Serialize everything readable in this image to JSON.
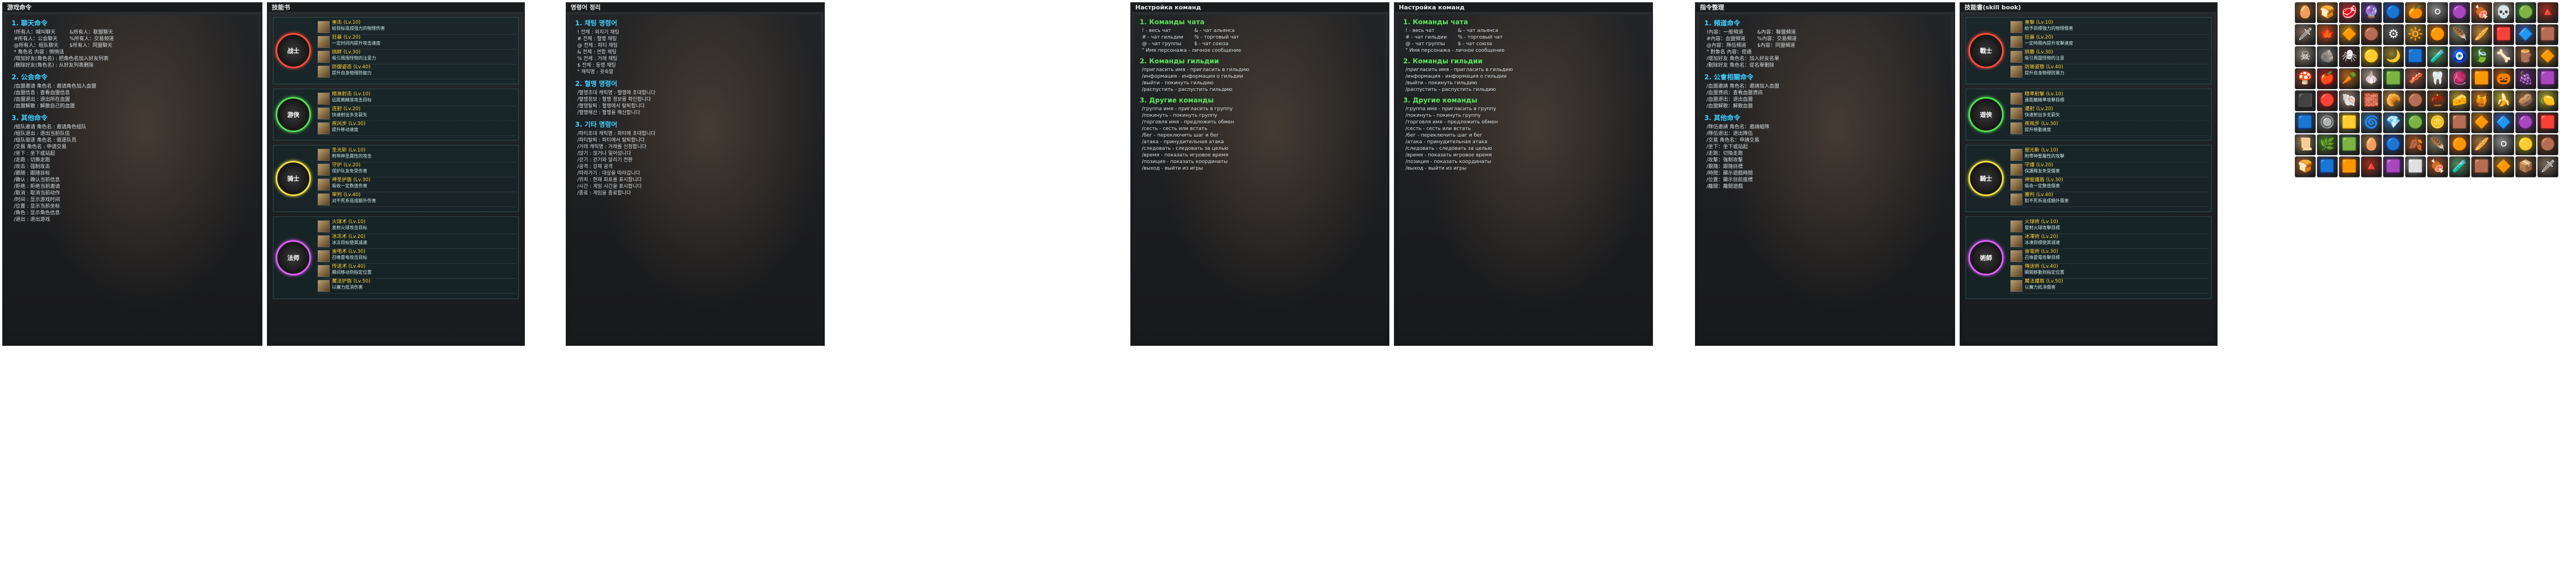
{
  "panels": {
    "p1": {
      "title": "游戏命令",
      "sections": [
        {
          "title": "1. 聊天命令",
          "cols": [
            [
              "!所有人：喊叫聊天",
              "#所有人：公会聊天",
              "@所有人：组队聊天"
            ],
            [
              "&所有人：联盟聊天",
              "%所有人：交易频道",
              "$所有人：同盟聊天"
            ]
          ],
          "lines": [
            "* 角色名 内容 : 悄悄话",
            "/增加好友(角色名) : 把角色名加入好友列表",
            "/删除好友(角色名) : 从好友列表删除"
          ]
        },
        {
          "title": "2. 公会命令",
          "lines": [
            "/血盟邀请 角色名 : 邀请角色加入血盟",
            "/血盟信息 : 查看血盟信息",
            "/血盟退出 : 退出所在血盟",
            "/血盟解散 : 解散自己的血盟"
          ]
        },
        {
          "title": "3. 其他命令",
          "lines": [
            "/组队邀请 角色名 : 邀请角色组队",
            "/组队退出 : 退出当前队伍",
            "/组队驱逐 角色名 : 驱逐队员",
            "/交易 角色名 : 申请交易",
            "/坐下 : 坐下或站起",
            "/走跑 : 切换走跑",
            "/攻击 : 强制攻击",
            "/跟随 : 跟随目标",
            "/确认 : 确认当前信息",
            "/拒绝 : 拒绝当前邀请",
            "/取消 : 取消当前动作",
            "/时间 : 显示游戏时间",
            "/位置 : 显示当前坐标",
            "/角色 : 显示角色信息",
            "/退出 : 退出游戏"
          ]
        }
      ]
    },
    "p2": {
      "title": "技能书",
      "groups": [
        {
          "badge": "战士",
          "color": "red",
          "skills": [
            {
              "name": "重击 (Lv.10)",
              "desc": "给目标造成强力的物理伤害"
            },
            {
              "name": "狂暴 (Lv.20)",
              "desc": "一定时间内提升攻击速度"
            },
            {
              "name": "挑衅 (Lv.30)",
              "desc": "吸引周围怪物的注意力"
            },
            {
              "name": "防御姿态 (Lv.40)",
              "desc": "提升自身物理防御力"
            }
          ]
        },
        {
          "badge": "游侠",
          "color": "green",
          "skills": [
            {
              "name": "精准射击 (Lv.10)",
              "desc": "远距离精准攻击目标"
            },
            {
              "name": "连射 (Lv.20)",
              "desc": "快速射出多支箭矢"
            },
            {
              "name": "疾风步 (Lv.30)",
              "desc": "提升移动速度"
            }
          ]
        },
        {
          "badge": "骑士",
          "color": "yellow",
          "skills": [
            {
              "name": "圣光斩 (Lv.10)",
              "desc": "附带神圣属性的攻击"
            },
            {
              "name": "守护 (Lv.20)",
              "desc": "保护队友免受伤害"
            },
            {
              "name": "神圣护盾 (Lv.30)",
              "desc": "吸收一定数值伤害"
            },
            {
              "name": "审判 (Lv.40)",
              "desc": "对不死系造成额外伤害"
            }
          ]
        },
        {
          "badge": "法师",
          "color": "pink",
          "skills": [
            {
              "name": "火球术 (Lv.10)",
              "desc": "发射火球攻击目标"
            },
            {
              "name": "冰冻术 (Lv.20)",
              "desc": "冰冻目标使其减速"
            },
            {
              "name": "雷电术 (Lv.30)",
              "desc": "召唤雷电攻击目标"
            },
            {
              "name": "传送术 (Lv.40)",
              "desc": "瞬间移动到指定位置"
            },
            {
              "name": "魔法护盾 (Lv.50)",
              "desc": "以魔力抵消伤害"
            }
          ]
        }
      ]
    },
    "p3": {
      "title": "명령어 정리",
      "sections": [
        {
          "title": "1. 채팅 명령어",
          "lines": [
            "! 전체 : 외치기 채팅",
            "# 전체 : 혈맹 채팅",
            "@ 전체 : 파티 채팅",
            "& 전체 : 연합 채팅",
            "% 전체 : 거래 채팅",
            "$ 전체 : 동맹 채팅",
            "\" 캐릭명 : 귓속말"
          ]
        },
        {
          "title": "2. 혈맹 명령어",
          "lines": [
            "/혈맹초대 캐릭명 : 혈맹에 초대합니다",
            "/혈맹정보 : 혈맹 정보를 확인합니다",
            "/혈맹탈퇴 : 혈맹에서 탈퇴합니다",
            "/혈맹해산 : 혈맹을 해산합니다"
          ]
        },
        {
          "title": "3. 기타 명령어",
          "lines": [
            "/파티초대 캐릭명 : 파티에 초대합니다",
            "/파티탈퇴 : 파티에서 탈퇴합니다",
            "/거래 캐릭명 : 거래를 신청합니다",
            "/앉기 : 앉거나 일어섭니다",
            "/걷기 : 걷기와 달리기 전환",
            "/공격 : 강제 공격",
            "/따라가기 : 대상을 따라갑니다",
            "/위치 : 현재 좌표를 표시합니다",
            "/시간 : 게임 시간을 표시합니다",
            "/종료 : 게임을 종료합니다"
          ]
        }
      ]
    },
    "p4": {
      "title": "Настройка команд",
      "sections": [
        {
          "title": "1. Команды чата",
          "cols": [
            [
              "! - весь чат",
              "# - чат гильдии",
              "@ - чат группы"
            ],
            [
              "& - чат альянса",
              "% - торговый чат",
              "$ - чат союза"
            ]
          ],
          "lines": [
            "\" Имя персонажа - личное сообщение"
          ]
        },
        {
          "title": "2. Команды гильдии",
          "lines": [
            "/пригласить имя - пригласить в гильдию",
            "/информация - информация о гильдии",
            "/выйти - покинуть гильдию",
            "/распустить - распустить гильдию"
          ]
        },
        {
          "title": "3. Другие команды",
          "lines": [
            "/группа имя - пригласить в группу",
            "/покинуть - покинуть группу",
            "/торговля имя - предложить обмен",
            "/сесть - сесть или встать",
            "/бег - переключить шаг и бег",
            "/атака - принудительная атака",
            "/следовать - следовать за целью",
            "/время - показать игровое время",
            "/позиция - показать координаты",
            "/выход - выйти из игры"
          ]
        }
      ]
    },
    "p5": {
      "title": "Настройка команд",
      "sections": [
        {
          "title": "1. Команды чата",
          "cols": [
            [
              "! - весь чат",
              "# - чат гильдии",
              "@ - чат группы"
            ],
            [
              "& - чат альянса",
              "% - торговый чат",
              "$ - чат союза"
            ]
          ],
          "lines": [
            "\" Имя персонажа - личное сообщение"
          ]
        },
        {
          "title": "2. Команды гильдии",
          "lines": [
            "/пригласить имя - пригласить в гильдию",
            "/информация - информация о гильдии",
            "/выйти - покинуть гильдию",
            "/распустить - распустить гильдию"
          ]
        },
        {
          "title": "3. Другие команды",
          "lines": [
            "/группа имя - пригласить в группу",
            "/покинуть - покинуть группу",
            "/торговля имя - предложить обмен",
            "/сесть - сесть или встать",
            "/бег - переключить шаг и бег",
            "/атака - принудительная атака",
            "/следовать - следовать за целью",
            "/время - показать игровое время",
            "/позиция - показать координаты",
            "/выход - выйти из игры"
          ]
        }
      ]
    },
    "p6": {
      "title": "指令整理",
      "sections": [
        {
          "title": "1. 頻道命令",
          "cols": [
            [
              "!內容：一般頻道",
              "#內容：血盟頻道",
              "@內容：隊伍頻道"
            ],
            [
              "&內容：聯盟頻道",
              "%內容：交易頻道",
              "$內容：同盟頻道"
            ]
          ],
          "lines": [
            "\" 對象名 內容：密語",
            "/增加好友 角色名：加入好友名單",
            "/刪除好友 角色名：從名單刪除"
          ]
        },
        {
          "title": "2. 公會相關命令",
          "lines": [
            "/血盟邀請 角色名：邀請加入血盟",
            "/血盟資訊：查看血盟資訊",
            "/血盟退出：退出血盟",
            "/血盟解散：解散血盟"
          ]
        },
        {
          "title": "3. 其他命令",
          "lines": [
            "/隊伍邀請 角色名：邀請組隊",
            "/隊伍退出：退出隊伍",
            "/交易 角色名：申請交易",
            "/坐下：坐下或站起",
            "/走跑：切換走跑",
            "/攻擊：強制攻擊",
            "/跟隨：跟隨目標",
            "/時間：顯示遊戲時間",
            "/位置：顯示目前座標",
            "/離開：離開遊戲"
          ]
        }
      ]
    },
    "p7": {
      "title": "技能書(skill book)",
      "groups": [
        {
          "badge": "戰士",
          "color": "red",
          "skills": [
            {
              "name": "重擊 (Lv.10)",
              "desc": "給予目標強力的物理傷害"
            },
            {
              "name": "狂暴 (Lv.20)",
              "desc": "一定時間內提升攻擊速度"
            },
            {
              "name": "挑釁 (Lv.30)",
              "desc": "吸引周圍怪物的注意"
            },
            {
              "name": "防禦姿態 (Lv.40)",
              "desc": "提升自身物理防禦力"
            }
          ]
        },
        {
          "badge": "遊俠",
          "color": "green",
          "skills": [
            {
              "name": "精準射擊 (Lv.10)",
              "desc": "遠距離精準攻擊目標"
            },
            {
              "name": "連射 (Lv.20)",
              "desc": "快速射出多支箭矢"
            },
            {
              "name": "疾風步 (Lv.30)",
              "desc": "提升移動速度"
            }
          ]
        },
        {
          "badge": "騎士",
          "color": "yellow",
          "skills": [
            {
              "name": "聖光斬 (Lv.10)",
              "desc": "附帶神聖屬性的攻擊"
            },
            {
              "name": "守護 (Lv.20)",
              "desc": "保護隊友免受傷害"
            },
            {
              "name": "神聖護盾 (Lv.30)",
              "desc": "吸收一定數值傷害"
            },
            {
              "name": "審判 (Lv.40)",
              "desc": "對不死系造成額外傷害"
            }
          ]
        },
        {
          "badge": "術師",
          "color": "pink",
          "skills": [
            {
              "name": "火球術 (Lv.10)",
              "desc": "發射火球攻擊目標"
            },
            {
              "name": "冰凍術 (Lv.20)",
              "desc": "冰凍目標使其減速"
            },
            {
              "name": "雷電術 (Lv.30)",
              "desc": "召喚雷電攻擊目標"
            },
            {
              "name": "傳送術 (Lv.40)",
              "desc": "瞬間移動到指定位置"
            },
            {
              "name": "魔法護盾 (Lv.50)",
              "desc": "以魔力抵消傷害"
            }
          ]
        }
      ]
    }
  },
  "inventory": {
    "items": [
      {
        "icon": "🥚",
        "color": "#8a5a2b"
      },
      {
        "icon": "🍞",
        "color": "#b07030"
      },
      {
        "icon": "🥩",
        "color": "#a03030"
      },
      {
        "icon": "🔮",
        "color": "#5a3a8a"
      },
      {
        "icon": "🔵",
        "color": "#2a4a9a"
      },
      {
        "icon": "🍊",
        "color": "#c07020"
      },
      {
        "icon": "⚪",
        "color": "#8a8a8a"
      },
      {
        "icon": "🟣",
        "color": "#6a3a8a"
      },
      {
        "icon": "🍖",
        "color": "#a05030"
      },
      {
        "icon": "💀",
        "color": "#9a9a8a"
      },
      {
        "icon": "🟢",
        "color": "#3a7a3a"
      },
      {
        "icon": "🔺",
        "color": "#9a3020"
      },
      {
        "icon": "🗡",
        "color": "#7a6a5a"
      },
      {
        "icon": "🍁",
        "color": "#b05020"
      },
      {
        "icon": "🔶",
        "color": "#b08020"
      },
      {
        "icon": "🟤",
        "color": "#6a4020"
      },
      {
        "icon": "⚙",
        "color": "#5a5a5a"
      },
      {
        "icon": "🔆",
        "color": "#a08030"
      },
      {
        "icon": "🟠",
        "color": "#b06020"
      },
      {
        "icon": "🪶",
        "color": "#7a7a6a"
      },
      {
        "icon": "🥖",
        "color": "#b08040"
      },
      {
        "icon": "🟥",
        "color": "#902020"
      },
      {
        "icon": "🔷",
        "color": "#3a5a9a"
      },
      {
        "icon": "🟫",
        "color": "#6a4a30"
      },
      {
        "icon": "☠",
        "color": "#8a8070"
      },
      {
        "icon": "🪨",
        "color": "#6a6a6a"
      },
      {
        "icon": "🕷",
        "color": "#4a3030"
      },
      {
        "icon": "🟡",
        "color": "#b09020"
      },
      {
        "icon": "🌙",
        "color": "#8a7a30"
      },
      {
        "icon": "🟦",
        "color": "#2a4a8a"
      },
      {
        "icon": "🧪",
        "color": "#5a8a5a"
      },
      {
        "icon": "🧿",
        "color": "#3a5a9a"
      },
      {
        "icon": "🍃",
        "color": "#4a7a30"
      },
      {
        "icon": "🦴",
        "color": "#9a9080"
      },
      {
        "icon": "🪵",
        "color": "#7a5030"
      },
      {
        "icon": "🔶",
        "color": "#a07020"
      },
      {
        "icon": "🍄",
        "color": "#8a4030"
      },
      {
        "icon": "🍎",
        "color": "#a02020"
      },
      {
        "icon": "🥕",
        "color": "#b06020"
      },
      {
        "icon": "🧄",
        "color": "#9a9080"
      },
      {
        "icon": "🟩",
        "color": "#3a7a3a"
      },
      {
        "icon": "🥓",
        "color": "#a05040"
      },
      {
        "icon": "🦷",
        "color": "#8a8070"
      },
      {
        "icon": "🧶",
        "color": "#7a4a6a"
      },
      {
        "icon": "🟧",
        "color": "#b06020"
      },
      {
        "icon": "🎃",
        "color": "#b05010"
      },
      {
        "icon": "🍇",
        "color": "#5a2a6a"
      },
      {
        "icon": "🟪",
        "color": "#6a3a8a"
      },
      {
        "icon": "⬛",
        "color": "#3a3a3a"
      },
      {
        "icon": "🔴",
        "color": "#9a2020"
      },
      {
        "icon": "🐚",
        "color": "#9a8070"
      },
      {
        "icon": "🧱",
        "color": "#8a4a30"
      },
      {
        "icon": "🥐",
        "color": "#b08040"
      },
      {
        "icon": "🟤",
        "color": "#6a4020"
      },
      {
        "icon": "🌰",
        "color": "#7a4a20"
      },
      {
        "icon": "🧀",
        "color": "#b09030"
      },
      {
        "icon": "🍯",
        "color": "#b07020"
      },
      {
        "icon": "🍌",
        "color": "#b0a030"
      },
      {
        "icon": "🥔",
        "color": "#8a6a40"
      },
      {
        "icon": "🍋",
        "color": "#a0a030"
      },
      {
        "icon": "🟦",
        "color": "#2a5a8a"
      },
      {
        "icon": "🔘",
        "color": "#6a6a6a"
      },
      {
        "icon": "🟨",
        "color": "#a09020"
      },
      {
        "icon": "🌀",
        "color": "#3a6a8a"
      },
      {
        "icon": "💎",
        "color": "#3a6a9a"
      },
      {
        "icon": "🟢",
        "color": "#3a7a3a"
      },
      {
        "icon": "🪙",
        "color": "#a08020"
      },
      {
        "icon": "🟫",
        "color": "#6a4a30"
      },
      {
        "icon": "🔶",
        "color": "#b07020"
      },
      {
        "icon": "🔷",
        "color": "#3a5a9a"
      },
      {
        "icon": "🟣",
        "color": "#6a3a8a"
      },
      {
        "icon": "🟥",
        "color": "#902020"
      },
      {
        "icon": "📜",
        "color": "#9a8060"
      },
      {
        "icon": "🌿",
        "color": "#4a7a30"
      },
      {
        "icon": "🟩",
        "color": "#3a6a3a"
      },
      {
        "icon": "🥚",
        "color": "#8a6a4a"
      },
      {
        "icon": "🔵",
        "color": "#2a4a9a"
      },
      {
        "icon": "🍂",
        "color": "#9a5020"
      },
      {
        "icon": "🪶",
        "color": "#7a7a6a"
      },
      {
        "icon": "🟠",
        "color": "#b06020"
      },
      {
        "icon": "🥖",
        "color": "#a07040"
      },
      {
        "icon": "⚪",
        "color": "#8a8a8a"
      },
      {
        "icon": "🟡",
        "color": "#a09020"
      },
      {
        "icon": "🟤",
        "color": "#6a4020"
      },
      {
        "icon": "🍞",
        "color": "#9a6030"
      },
      {
        "icon": "🟦",
        "color": "#2a4a8a"
      },
      {
        "icon": "🟧",
        "color": "#b06020"
      },
      {
        "icon": "🔺",
        "color": "#9a3020"
      },
      {
        "icon": "🟪",
        "color": "#6a3a8a"
      },
      {
        "icon": "⬜",
        "color": "#8a8a8a"
      },
      {
        "icon": "🍖",
        "color": "#a05030"
      },
      {
        "icon": "🧪",
        "color": "#5a8a5a"
      },
      {
        "icon": "🟫",
        "color": "#6a4a30"
      },
      {
        "icon": "🔶",
        "color": "#a07020"
      },
      {
        "icon": "📦",
        "color": "#7a5030"
      },
      {
        "icon": "🗡",
        "color": "#7a6a5a"
      }
    ]
  }
}
